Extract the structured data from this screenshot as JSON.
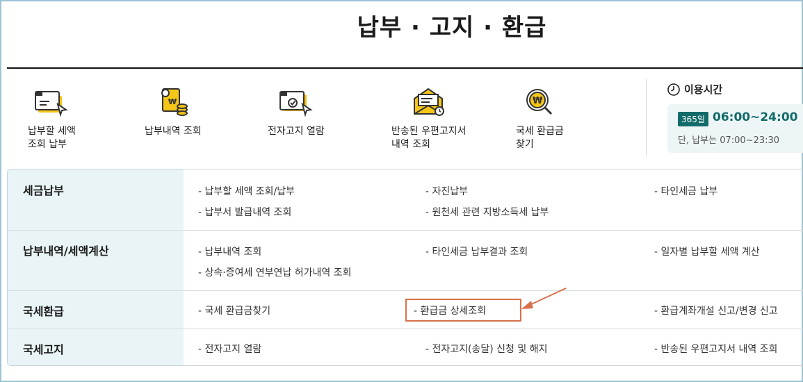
{
  "page": {
    "title": "납부 · 고지 · 환급"
  },
  "quick_menu": [
    {
      "label": "납부할 세액\n조회 납부",
      "icon": "tax-inquiry-icon"
    },
    {
      "label": "납부내역 조회",
      "icon": "payment-history-icon"
    },
    {
      "label": "전자고지 열람",
      "icon": "e-notice-icon"
    },
    {
      "label": "반송된 우편고지서\n내역 조회",
      "icon": "returned-mail-icon"
    },
    {
      "label": "국세 환급금\n찾기",
      "icon": "refund-search-icon"
    }
  ],
  "hours": {
    "title": "이용시간",
    "badge": "365일",
    "time": "06:00~24:00",
    "note": "단, 납부는 07:00~23:30"
  },
  "menu": {
    "rows": [
      {
        "category": "세금납부",
        "links": [
          "- 납부할 세액 조회/납부",
          "- 자진납부",
          "- 타인세금 납부",
          "- 납부서 발급내역 조회",
          "- 원천세 관련 지방소득세 납부"
        ]
      },
      {
        "category": "납부내역/세액계산",
        "links": [
          "- 납부내역 조회",
          "- 타인세금 납부결과 조회",
          "- 일자별 납부할 세액 계산",
          "- 상속·증여세 연부연납 허가내역 조회"
        ]
      },
      {
        "category": "국세환급",
        "links": [
          "- 국세 환급금찾기",
          "- 환급금 상세조회",
          "- 환급계좌개설 신고/변경 신고"
        ]
      },
      {
        "category": "국세고지",
        "links": [
          "- 전자고지 열람",
          "- 전자고지(송달) 신청 및 해지",
          "- 반송된 우편고지서 내역 조회"
        ]
      }
    ]
  },
  "colors": {
    "accent": "#116b69",
    "side_bg": "#e9f4f6",
    "annotation": "#d9704a",
    "icon_yellow": "#f5c518"
  }
}
